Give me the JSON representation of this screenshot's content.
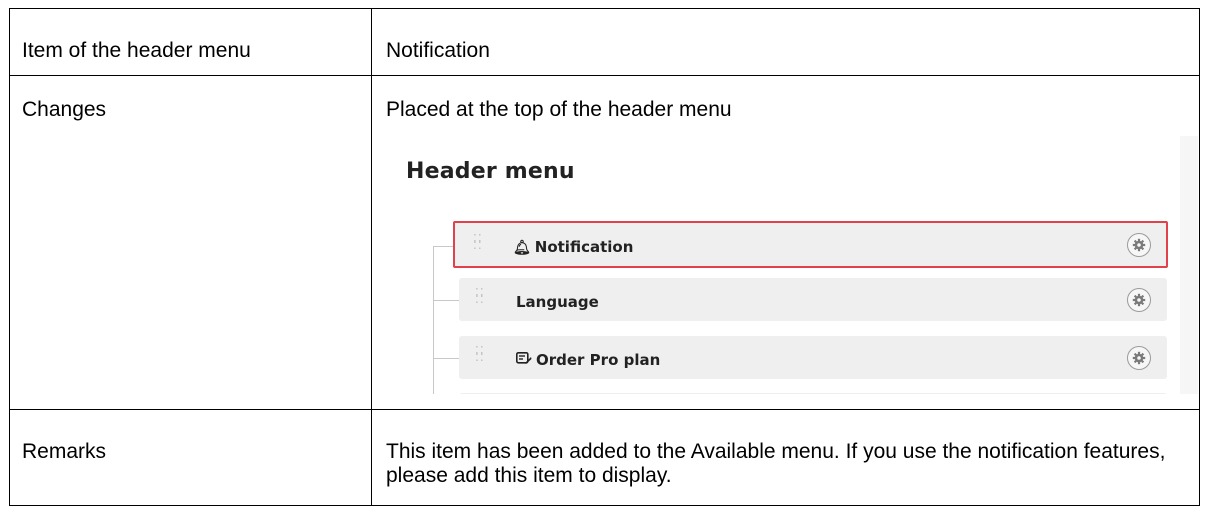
{
  "table": {
    "row1": {
      "label": "Item of the header menu",
      "value": "Notification"
    },
    "row2": {
      "label": "Changes",
      "value": "Placed at the top of the header menu"
    },
    "row3": {
      "label": "Remarks",
      "value": "This item has been added to the Available menu. If you use the notification features, please add this item to display."
    }
  },
  "screenshot": {
    "title": "Header menu",
    "items": [
      {
        "label": "Notification",
        "icon": "bell-icon",
        "highlighted": true
      },
      {
        "label": "Language",
        "icon": "",
        "highlighted": false
      },
      {
        "label": "Order Pro plan",
        "icon": "order-icon",
        "highlighted": false
      }
    ],
    "highlight_color": "#e0414b"
  }
}
